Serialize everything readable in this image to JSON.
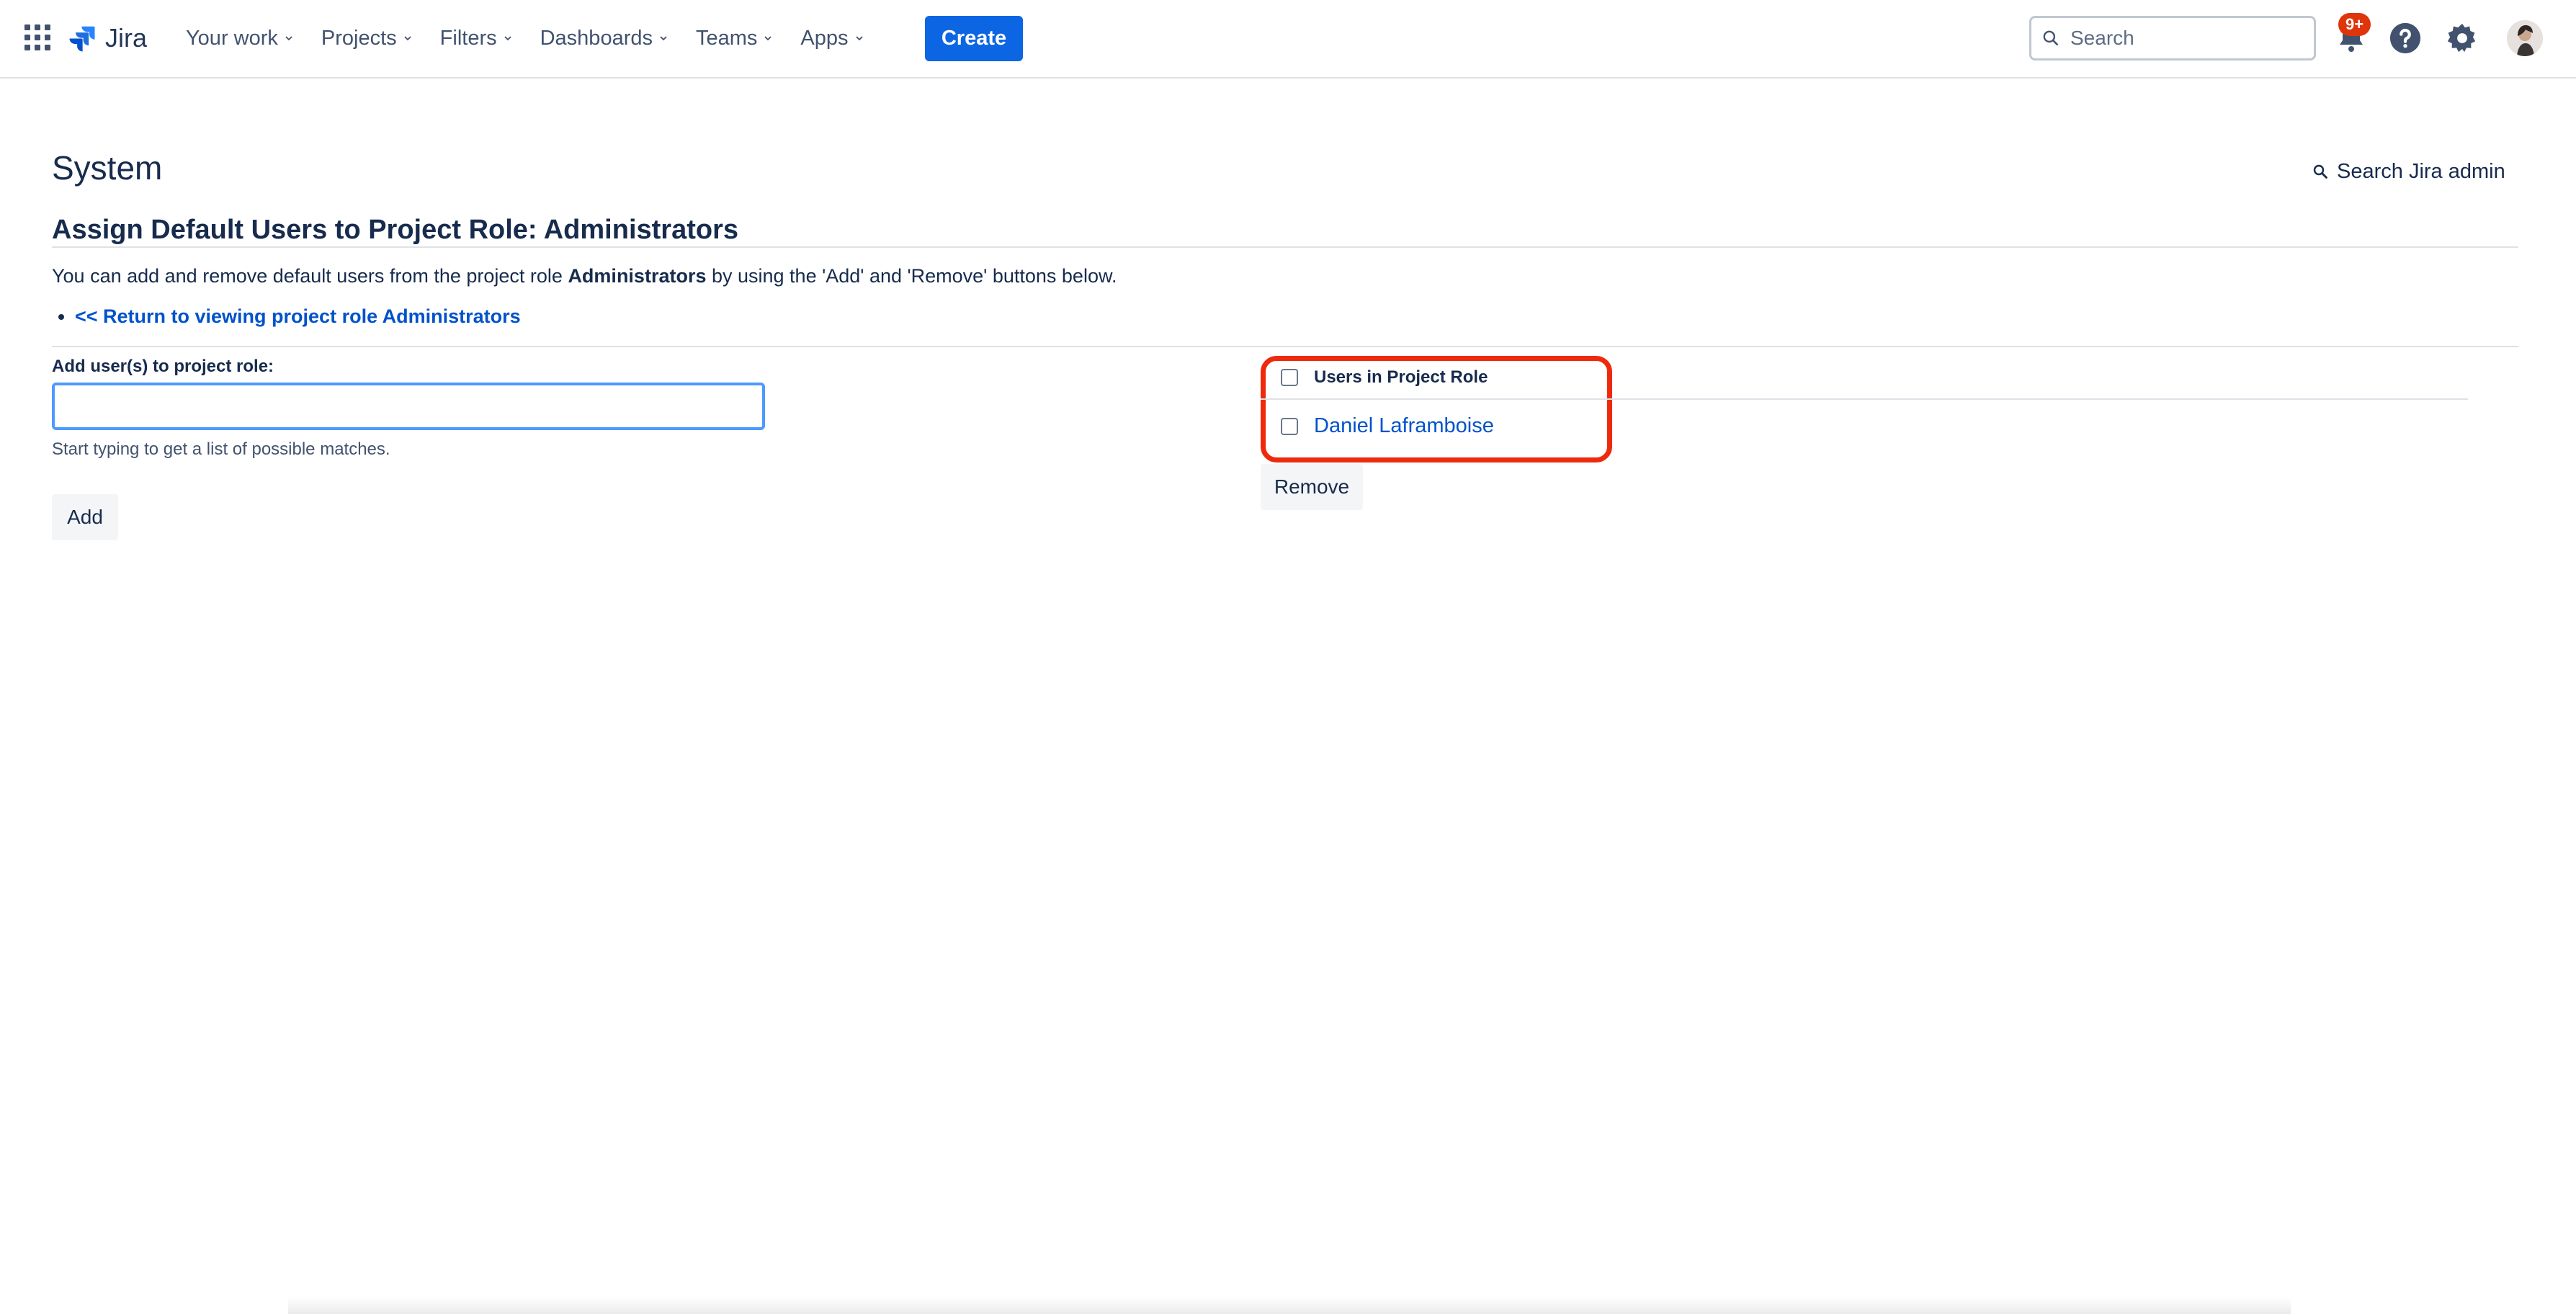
{
  "topnav": {
    "logo_text": "Jira",
    "items": [
      {
        "label": "Your work"
      },
      {
        "label": "Projects"
      },
      {
        "label": "Filters"
      },
      {
        "label": "Dashboards"
      },
      {
        "label": "Teams"
      },
      {
        "label": "Apps"
      }
    ],
    "create_label": "Create",
    "search_placeholder": "Search",
    "notification_badge": "9+",
    "icons": {
      "apps": "app-switcher-icon",
      "notifications": "bell-icon",
      "help": "help-icon",
      "settings": "gear-icon"
    }
  },
  "page": {
    "title": "System",
    "admin_search": "Search Jira admin",
    "section_title": "Assign Default Users to Project Role: Administrators",
    "desc_pre": "You can add and remove default users from the project role ",
    "desc_role": "Administrators",
    "desc_post": " by using the 'Add' and 'Remove' buttons below.",
    "return_link": "<< Return to viewing project role Administrators"
  },
  "add_panel": {
    "label": "Add user(s) to project role:",
    "input_value": "",
    "hint": "Start typing to get a list of possible matches.",
    "add_label": "Add"
  },
  "role_panel": {
    "header": "Users in Project Role",
    "users": [
      {
        "name": "Daniel Laframboise",
        "checked": false
      }
    ],
    "remove_label": "Remove"
  },
  "colors": {
    "primary": "#0c66e4",
    "link": "#0052cc",
    "highlight": "#ee2a0d",
    "badge": "#de350b"
  }
}
